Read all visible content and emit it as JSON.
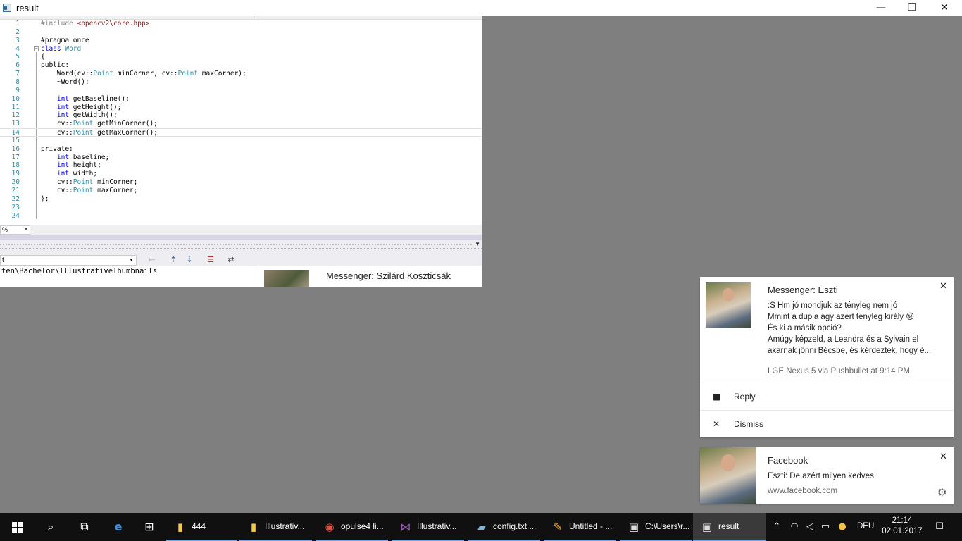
{
  "window": {
    "title": "result",
    "controls": {
      "minimize": "—",
      "maximize": "❐",
      "close": "✕"
    }
  },
  "code_lines": [
    {
      "n": "1"
    },
    {
      "n": "2"
    },
    {
      "n": "3"
    },
    {
      "n": "4"
    },
    {
      "n": "5"
    },
    {
      "n": "6"
    },
    {
      "n": "7"
    },
    {
      "n": "8"
    },
    {
      "n": "9"
    },
    {
      "n": "10"
    },
    {
      "n": "11"
    },
    {
      "n": "12"
    },
    {
      "n": "13"
    },
    {
      "n": "14"
    },
    {
      "n": "15"
    },
    {
      "n": "16"
    },
    {
      "n": "17"
    },
    {
      "n": "18"
    },
    {
      "n": "19"
    },
    {
      "n": "20"
    },
    {
      "n": "21"
    },
    {
      "n": "22"
    },
    {
      "n": "23"
    },
    {
      "n": "24"
    }
  ],
  "code": {
    "l1_dir": "#include ",
    "l1_str": "<opencv2\\core.hpp>",
    "l3": "#pragma once",
    "l4_kw": "class ",
    "l4_ty": "Word",
    "l5": "{",
    "l6": "public:",
    "l7_a": "    Word(cv::",
    "l7_b": "Point",
    "l7_c": " minCorner, cv::",
    "l7_d": "Point",
    "l7_e": " maxCorner);",
    "l8": "    ~Word();",
    "l10_kw": "    int",
    "l10_rest": " getBaseline();",
    "l11_kw": "    int",
    "l11_rest": " getHeight();",
    "l12_kw": "    int",
    "l12_rest": " getWidth();",
    "l13_a": "    cv::",
    "l13_b": "Point",
    "l13_c": " getMinCorner();",
    "l14_a": "    cv::",
    "l14_b": "Point",
    "l14_c": " getMaxCorner();",
    "l16": "private:",
    "l17_kw": "    int",
    "l17_rest": " baseline;",
    "l18_kw": "    int",
    "l18_rest": " height;",
    "l19_kw": "    int",
    "l19_rest": " width;",
    "l20_a": "    cv::",
    "l20_b": "Point",
    "l20_c": " minCorner;",
    "l21_a": "    cv::",
    "l21_b": "Point",
    "l21_c": " maxCorner;",
    "l22": "};"
  },
  "editor": {
    "zoom": "%",
    "output_select": "t",
    "output_path": "ten\\Bachelor\\IllustrativeThumbnails",
    "peek_title": "Messenger: Szilárd Koszticsák"
  },
  "notification_messenger": {
    "title": "Messenger: Eszti",
    "lines": [
      ":S Hm jó mondjuk az tényleg nem jó",
      "Mmint a dupla ágy azért tényleg király 😛",
      "És ki a másik opció?",
      "Amúgy képzeld, a Leandra és a Sylvain el",
      "akarnak jönni Bécsbe, és kérdezték, hogy é..."
    ],
    "meta": "LGE Nexus 5 via Pushbullet at 9:14 PM",
    "reply": "Reply",
    "dismiss": "Dismiss",
    "close": "✕"
  },
  "notification_facebook": {
    "title": "Facebook",
    "body": "Eszti: De azért milyen kedves!",
    "source": "www.facebook.com",
    "close": "✕"
  },
  "taskbar": {
    "apps": [
      {
        "label": "444",
        "icon": "folder-icon"
      },
      {
        "label": "Illustrativ...",
        "icon": "folder-icon"
      },
      {
        "label": "opulse4 li...",
        "icon": "chrome-icon"
      },
      {
        "label": "Illustrativ...",
        "icon": "visual-studio-icon"
      },
      {
        "label": "config.txt ...",
        "icon": "notepad-icon"
      },
      {
        "label": "Untitled - ...",
        "icon": "paint-icon"
      },
      {
        "label": "C:\\Users\\r...",
        "icon": "console-icon"
      },
      {
        "label": "result",
        "icon": "app-window-icon"
      }
    ],
    "language": "DEU",
    "time": "21:14",
    "date": "02.01.2017"
  },
  "colors": {
    "desktop": "#7f7f7f",
    "taskbar": "#101010",
    "keyword": "#0000ff",
    "type": "#2b91af",
    "string": "#a31515",
    "preprocessor": "#808080"
  }
}
